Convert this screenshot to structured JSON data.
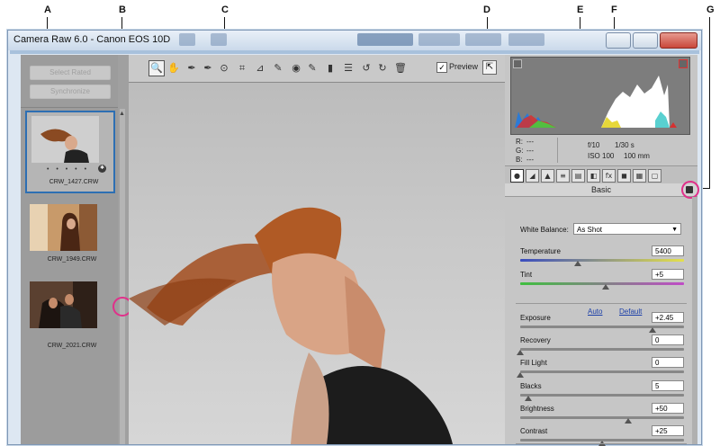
{
  "window": {
    "title": "Camera Raw 6.0  -  Canon EOS 10D"
  },
  "callouts": [
    "A",
    "B",
    "C",
    "D",
    "E",
    "F",
    "G"
  ],
  "filmstrip": {
    "select_rated": "Select Rated",
    "synchronize": "Synchronize",
    "thumbnails": [
      {
        "name": "CRW_1427.CRW",
        "stars": "• • • • •",
        "selected": true
      },
      {
        "name": "CRW_1949.CRW",
        "selected": false
      },
      {
        "name": "CRW_2021.CRW",
        "selected": false
      }
    ]
  },
  "toolbar": {
    "tools": [
      {
        "icon": "zoom-tool-icon",
        "glyph": "🔍"
      },
      {
        "icon": "hand-tool-icon",
        "glyph": "✋"
      },
      {
        "icon": "white-balance-tool-icon",
        "glyph": "✒"
      },
      {
        "icon": "color-sampler-tool-icon",
        "glyph": "✒"
      },
      {
        "icon": "targeted-adjustment-tool-icon",
        "glyph": "⊙"
      },
      {
        "icon": "crop-tool-icon",
        "glyph": "⌗"
      },
      {
        "icon": "straighten-tool-icon",
        "glyph": "⊿"
      },
      {
        "icon": "spot-removal-tool-icon",
        "glyph": "✎"
      },
      {
        "icon": "red-eye-removal-tool-icon",
        "glyph": "◉"
      },
      {
        "icon": "adjustment-brush-icon",
        "glyph": "✎"
      },
      {
        "icon": "graduated-filter-icon",
        "glyph": "▮"
      },
      {
        "icon": "preferences-icon",
        "glyph": "☰"
      },
      {
        "icon": "rotate-left-icon",
        "glyph": "↺"
      },
      {
        "icon": "rotate-right-icon",
        "glyph": "↻"
      },
      {
        "icon": "trash-icon",
        "glyph": "🗑"
      }
    ],
    "preview_label": "Preview",
    "preview_checked": true
  },
  "info": {
    "r_label": "R:",
    "r_value": "---",
    "g_label": "G:",
    "g_value": "---",
    "b_label": "B:",
    "b_value": "---",
    "aperture": "f/10",
    "shutter": "1/30 s",
    "iso": "ISO 100",
    "focal": "100 mm"
  },
  "panel": {
    "title": "Basic",
    "tabs": [
      "●",
      "◢",
      "▲",
      "≡",
      "▤",
      "◧",
      "fx",
      "◼",
      "▦",
      "▢"
    ],
    "white_balance_label": "White Balance:",
    "white_balance_value": "As Shot",
    "auto": "Auto",
    "default": "Default",
    "sliders": [
      {
        "label": "Temperature",
        "value": "5400",
        "fraction": 0.35
      },
      {
        "label": "Tint",
        "value": "+5",
        "fraction": 0.52
      },
      {
        "label": "Exposure",
        "value": "+2.45",
        "fraction": 0.81
      },
      {
        "label": "Recovery",
        "value": "0",
        "fraction": 0.0
      },
      {
        "label": "Fill Light",
        "value": "0",
        "fraction": 0.0
      },
      {
        "label": "Blacks",
        "value": "5",
        "fraction": 0.05
      },
      {
        "label": "Brightness",
        "value": "+50",
        "fraction": 0.66
      },
      {
        "label": "Contrast",
        "value": "+25",
        "fraction": 0.5
      }
    ]
  },
  "colors": {
    "accent": "#e0308a",
    "selection": "#2d6fb3",
    "link": "#1a3ea8"
  }
}
